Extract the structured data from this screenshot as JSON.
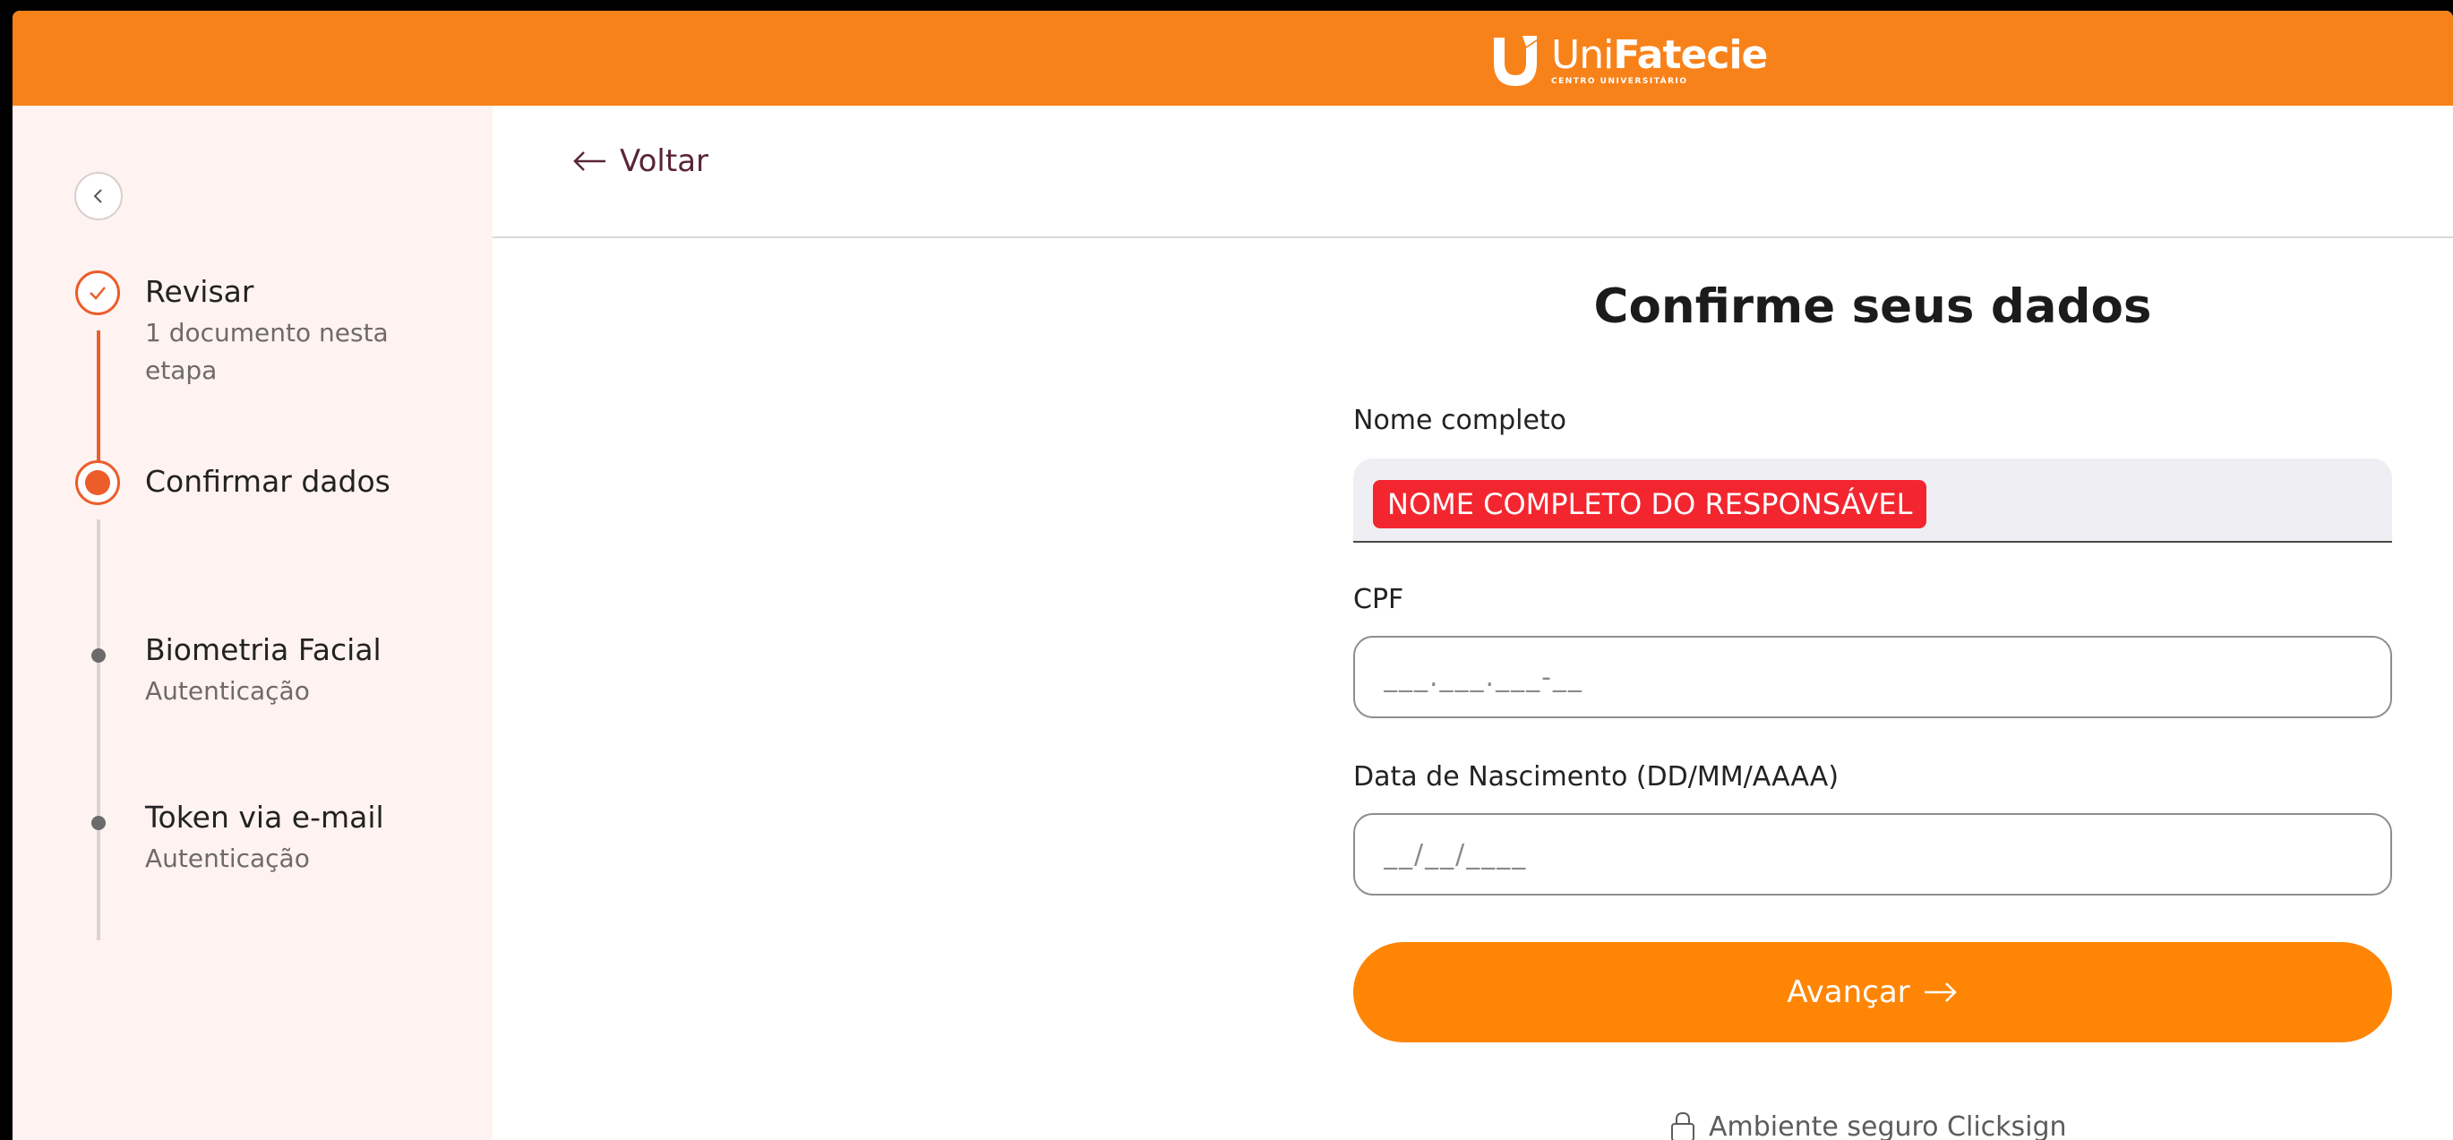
{
  "header": {
    "brand_name_uni": "Uni",
    "brand_name_rest": "Fatecie",
    "brand_subtitle": "CENTRO UNIVERSITÁRIO"
  },
  "sidebar": {
    "steps": [
      {
        "title": "Revisar",
        "subtitle": "1 documento nesta etapa",
        "state": "done"
      },
      {
        "title": "Confirmar dados",
        "subtitle": "",
        "state": "active"
      },
      {
        "title": "Biometria Facial",
        "subtitle": "Autenticação",
        "state": "pending"
      },
      {
        "title": "Token via e-mail",
        "subtitle": "Autenticação",
        "state": "pending"
      }
    ]
  },
  "main": {
    "back_label": "Voltar",
    "title": "Confirme seus dados",
    "name_label": "Nome completo",
    "name_value": "NOME COMPLETO DO RESPONSÁVEL",
    "cpf_label": "CPF",
    "cpf_placeholder": "___.___.___-__",
    "birth_label": "Data de Nascimento (DD/MM/AAAA)",
    "birth_placeholder": "__/__/____",
    "submit_label": "Avançar",
    "secure_text": "Ambiente seguro Clicksign"
  },
  "colors": {
    "brand": "#f8821a",
    "accent": "#ec5d2a",
    "button": "#ff8505",
    "sidebar_bg": "#fff3f1"
  },
  "icons": [
    "chevron-left-icon",
    "check-icon",
    "arrow-left-icon",
    "arrow-right-icon",
    "lock-icon"
  ]
}
